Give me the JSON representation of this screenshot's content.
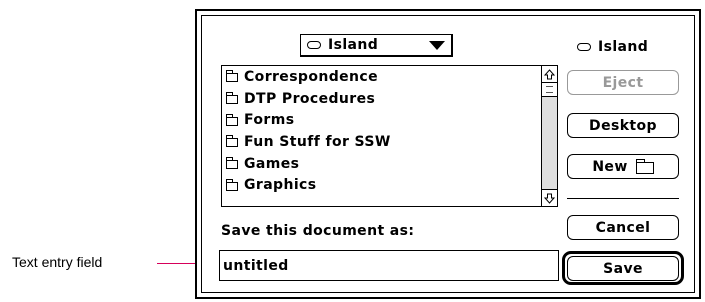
{
  "callout": {
    "label": "Text entry field",
    "line_color": "#d6005a"
  },
  "dialog": {
    "folder_popup": {
      "selected": "Island",
      "icon": "disk-icon",
      "arrow_icon": "triangle-down-icon"
    },
    "file_list": {
      "items": [
        {
          "label": "Correspondence",
          "icon": "folder-icon"
        },
        {
          "label": "DTP Procedures",
          "icon": "folder-icon"
        },
        {
          "label": "Forms",
          "icon": "folder-icon"
        },
        {
          "label": "Fun Stuff for SSW",
          "icon": "folder-icon"
        },
        {
          "label": "Games",
          "icon": "folder-icon"
        },
        {
          "label": "Graphics",
          "icon": "folder-icon"
        }
      ],
      "scroll_up_icon": "scroll-up-arrow-icon",
      "scroll_down_icon": "scroll-down-arrow-icon"
    },
    "volume": {
      "name": "Island",
      "icon": "disk-icon"
    },
    "buttons": {
      "eject": "Eject",
      "desktop": "Desktop",
      "new": "New",
      "cancel": "Cancel",
      "save": "Save"
    },
    "prompt": "Save this document as:",
    "filename_value": "untitled",
    "colors": {
      "disabled_text": "#999999",
      "scroll_track_pattern": "#808080"
    }
  }
}
